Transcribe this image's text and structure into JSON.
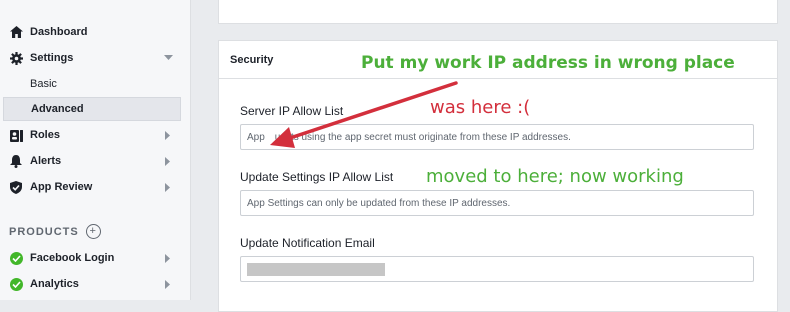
{
  "sidebar": {
    "items": [
      {
        "label": "Dashboard",
        "icon": "home-icon"
      },
      {
        "label": "Settings",
        "icon": "gear-icon",
        "expanded": true
      },
      {
        "label": "Roles",
        "icon": "roles-icon"
      },
      {
        "label": "Alerts",
        "icon": "bell-icon"
      },
      {
        "label": "App Review",
        "icon": "shield-check-icon"
      }
    ],
    "settings_sub": [
      {
        "label": "Basic"
      },
      {
        "label": "Advanced",
        "active": true
      }
    ],
    "products_label": "PRODUCTS",
    "products": [
      {
        "label": "Facebook Login",
        "icon": "green-check-icon"
      },
      {
        "label": "Analytics",
        "icon": "green-check-icon"
      }
    ]
  },
  "security": {
    "title": "Security",
    "server_ip_label": "Server IP Allow List",
    "server_ip_placeholder": "App requests using the app secret must originate from these IP addresses.",
    "server_ip_visible_start": "App",
    "server_ip_visible_end": "uests using the app secret must originate from these IP addresses.",
    "update_ip_label": "Update Settings IP Allow List",
    "update_ip_placeholder": "App Settings can only be updated from these IP addresses.",
    "notification_label": "Update Notification Email"
  },
  "annotations": {
    "headline": "Put my work IP address in wrong place",
    "was_here": "was here :(",
    "moved": "moved to here; now working",
    "green_color": "#4caf3a",
    "red_color": "#d32f3c"
  },
  "colors": {
    "background": "#e9ebee",
    "sidebar": "#f6f7f9",
    "success_green": "#42b72a"
  }
}
